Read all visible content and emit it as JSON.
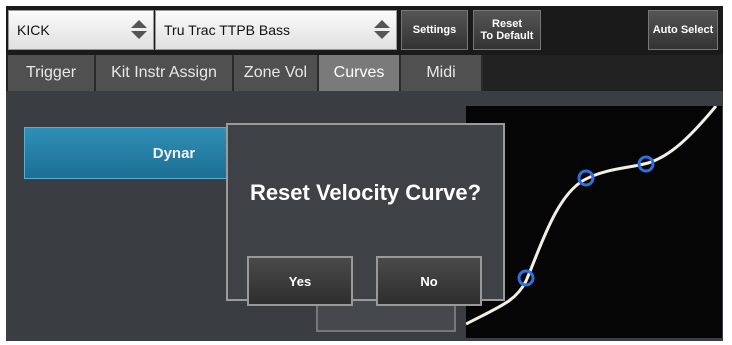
{
  "toolbar": {
    "pad_selector": {
      "value": "KICK"
    },
    "instrument_selector": {
      "value": "Tru Trac TTPB Bass"
    },
    "settings_label": "Settings",
    "reset_label_line1": "Reset",
    "reset_label_line2": "To Default",
    "auto_select_label": "Auto Select"
  },
  "tabs": [
    {
      "label": "Trigger",
      "active": false
    },
    {
      "label": "Kit Instr Assign",
      "active": false
    },
    {
      "label": "Zone Vol",
      "active": false
    },
    {
      "label": "Curves",
      "active": true
    },
    {
      "label": "Midi",
      "active": false
    }
  ],
  "content": {
    "dynamic_button_label": "Dynar"
  },
  "dialog": {
    "title": "Reset Velocity Curve?",
    "yes_label": "Yes",
    "no_label": "No"
  },
  "colors": {
    "accent": "#2a85b0",
    "curve": "#f2f0e6",
    "curve_point": "#2f6fe0"
  }
}
